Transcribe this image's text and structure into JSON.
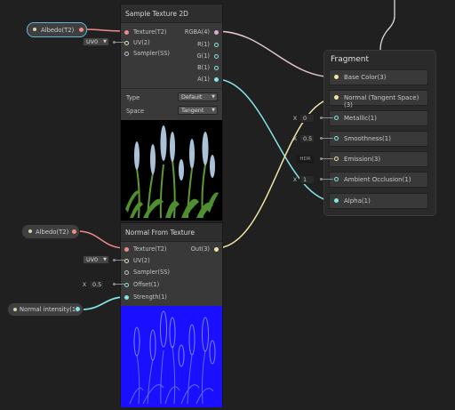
{
  "colors": {
    "background": "#202020",
    "wire_texture": "#f28a8a",
    "wire_vector4": "#f0e3a4",
    "wire_vector1": "#84e4e7",
    "wire_uv": "#cfe7b4"
  },
  "nodes": {
    "albedo_prop": {
      "label": "Albedo(T2)"
    },
    "albedo_prop2": {
      "label": "Albedo(T2)"
    },
    "normal_intensity": {
      "label": "Normal intensity(1)"
    },
    "sample_texture": {
      "title": "Sample Texture 2D",
      "inputs": [
        "Texture(T2)",
        "UV(2)",
        "Sampler(SS)"
      ],
      "outputs": [
        "RGBA(4)",
        "R(1)",
        "G(1)",
        "B(1)",
        "A(1)"
      ],
      "type_label": "Type",
      "type_value": "Default",
      "space_label": "Space",
      "space_value": "Tangent",
      "uv_default": "UV0"
    },
    "normal_from_texture": {
      "title": "Normal From Texture",
      "inputs": [
        "Texture(T2)",
        "UV(2)",
        "Sampler(SS)",
        "Offset(1)",
        "Strength(1)"
      ],
      "outputs": [
        "Out(3)"
      ],
      "uv_default": "UV0",
      "offset_axis": "X",
      "offset_value": "0.5"
    },
    "fragment": {
      "title": "Fragment",
      "slots": [
        {
          "label": "Base Color(3)"
        },
        {
          "label": "Normal (Tangent Space)(3)"
        },
        {
          "label": "Metallic(1)",
          "axis": "X",
          "value": "0"
        },
        {
          "label": "Smoothness(1)",
          "axis": "X",
          "value": "0.5"
        },
        {
          "label": "Emission(3)",
          "hdr": "HDR"
        },
        {
          "label": "Ambient Occlusion(1)",
          "axis": "X",
          "value": "1"
        },
        {
          "label": "Alpha(1)"
        }
      ]
    }
  }
}
